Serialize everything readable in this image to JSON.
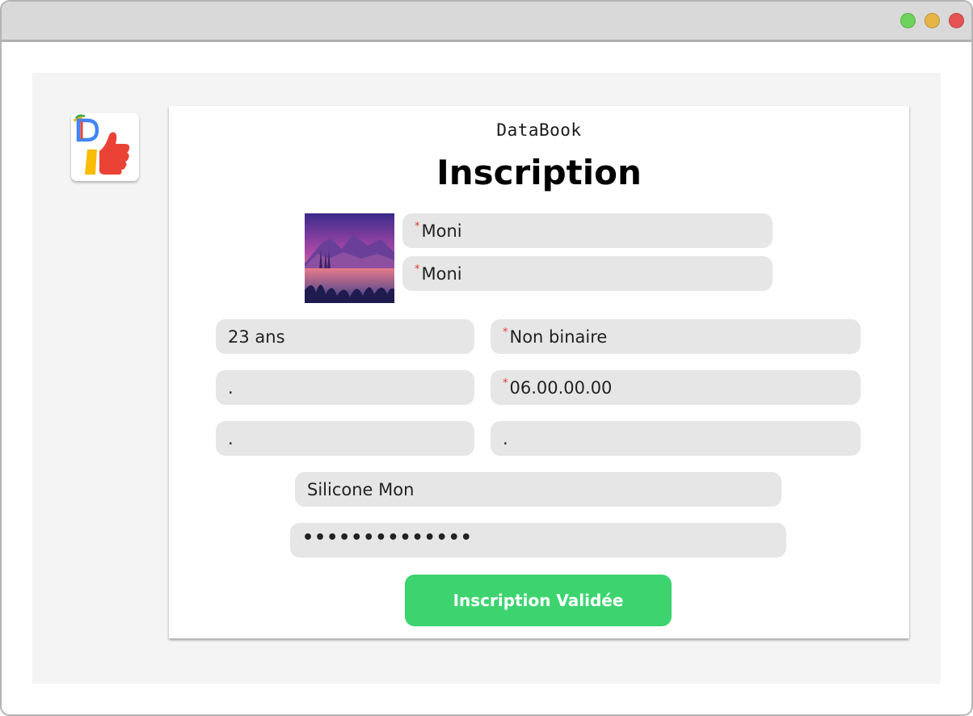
{
  "window": {
    "controls": [
      {
        "name": "maximize",
        "color": "#6dd35a"
      },
      {
        "name": "minimize",
        "color": "#e6b447"
      },
      {
        "name": "close",
        "color": "#e55353"
      }
    ]
  },
  "logo": {
    "icon": "databook-thumbs-up-logo",
    "letter": "D"
  },
  "form": {
    "brand": "DataBook",
    "title": "Inscription",
    "avatar_icon": "mountain-lake-landscape-image",
    "fields": {
      "first_name": {
        "value": "Moni",
        "required": true
      },
      "last_name": {
        "value": "Moni",
        "required": true
      },
      "age": {
        "value": "23 ans",
        "required": false
      },
      "gender": {
        "value": "Non binaire",
        "required": true
      },
      "field_left_1": {
        "value": ".",
        "required": false
      },
      "phone": {
        "value": "06.00.00.00",
        "required": true
      },
      "field_left_2": {
        "value": ".",
        "required": false
      },
      "field_right_2": {
        "value": ".",
        "required": false
      },
      "username": {
        "value": "Silicone Mon",
        "required": false
      },
      "password": {
        "value": "••••••••••••••",
        "required": false
      }
    },
    "submit_label": "Inscription Validée"
  },
  "colors": {
    "submit": "#3dd470",
    "field_bg": "#e6e6e6",
    "required_marker": "#e53935",
    "canvas_bg": "#f4f4f4"
  }
}
